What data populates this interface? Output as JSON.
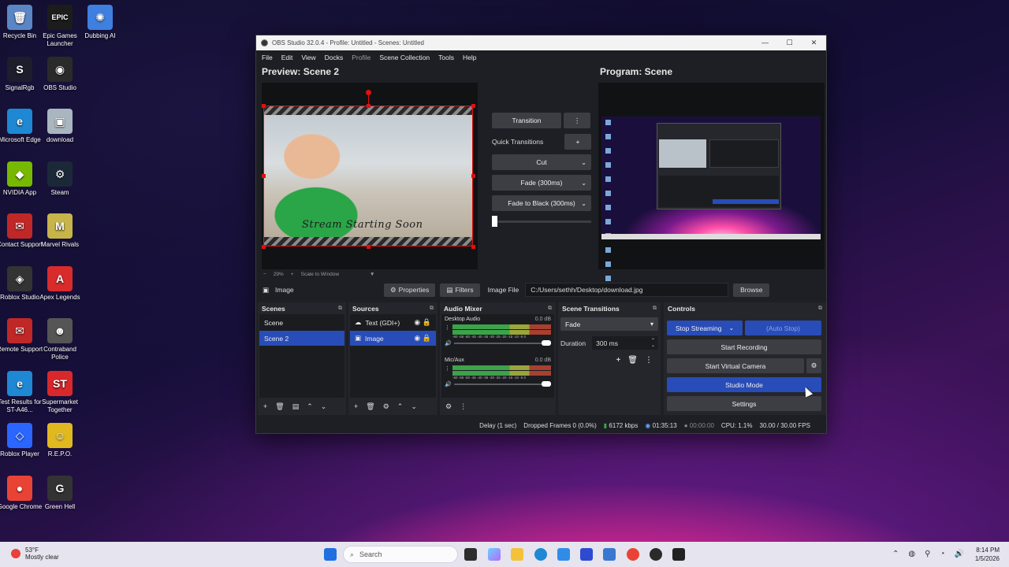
{
  "desktop": {
    "icons": [
      {
        "label": "Recycle Bin",
        "glyph": "🗑",
        "color": "#5b86c6"
      },
      {
        "label": "Epic Games Launcher",
        "glyph": "EPIC",
        "color": "#1c1c1c"
      },
      {
        "label": "Dubbing AI",
        "glyph": "✺",
        "color": "#3f7fe0"
      },
      {
        "label": "SignalRgb",
        "glyph": "S",
        "color": "#1d1d2c"
      },
      {
        "label": "OBS Studio",
        "glyph": "◉",
        "color": "#2a2a2a"
      },
      {
        "label": "Microsoft Edge",
        "glyph": "e",
        "color": "#1e88d4"
      },
      {
        "label": "download",
        "glyph": "▣",
        "color": "#a9b6c0"
      },
      {
        "label": "NVIDIA App",
        "glyph": "◆",
        "color": "#76b900"
      },
      {
        "label": "Steam",
        "glyph": "⚙",
        "color": "#1b2838"
      },
      {
        "label": "Contact Support",
        "glyph": "✉",
        "color": "#c02828"
      },
      {
        "label": "Marvel Rivals",
        "glyph": "M",
        "color": "#c7b44a"
      },
      {
        "label": "Roblox Studio",
        "glyph": "◈",
        "color": "#333"
      },
      {
        "label": "Apex Legends",
        "glyph": "A",
        "color": "#d82b2b"
      },
      {
        "label": "Remote Support",
        "glyph": "✉",
        "color": "#c02828"
      },
      {
        "label": "Contraband Police",
        "glyph": "☻",
        "color": "#555"
      },
      {
        "label": "Test Results for ST-A46...",
        "glyph": "e",
        "color": "#1e88d4"
      },
      {
        "label": "Supermarket Together",
        "glyph": "ST",
        "color": "#d8282b"
      },
      {
        "label": "Roblox Player",
        "glyph": "◇",
        "color": "#2a66ff"
      },
      {
        "label": "R.E.P.O.",
        "glyph": "☺",
        "color": "#e0b820"
      },
      {
        "label": "Google Chrome",
        "glyph": "●",
        "color": "#e94335"
      },
      {
        "label": "Green Hell",
        "glyph": "G",
        "color": "#333"
      }
    ]
  },
  "window": {
    "title": "OBS Studio 32.0.4 - Profile: Untitled - Scenes: Untitled",
    "controls": {
      "minimize": "—",
      "maximize": "☐",
      "close": "✕"
    }
  },
  "menu": [
    "File",
    "Edit",
    "View",
    "Docks",
    "Profile",
    "Scene Collection",
    "Tools",
    "Help"
  ],
  "preview": {
    "title": "Preview: Scene 2",
    "overlay_text": "Stream Starting Soon",
    "zoom": "29%",
    "zoom_minus": "−",
    "zoom_plus": "+",
    "zoom_mode": "Scale to Window"
  },
  "program": {
    "title": "Program: Scene"
  },
  "transitions_panel": {
    "transition_label": "Transition",
    "quick_transitions_label": "Quick Transitions",
    "quick_list": [
      "Cut",
      "Fade (300ms)",
      "Fade to Black (300ms)"
    ]
  },
  "properties_bar": {
    "source_name": "Image",
    "properties_label": "Properties",
    "filters_label": "Filters",
    "image_file_label": "Image File",
    "path": "C:/Users/sethh/Desktop/download.jpg",
    "browse_label": "Browse"
  },
  "scenes": {
    "title": "Scenes",
    "items": [
      "Scene",
      "Scene 2"
    ],
    "selected": 1
  },
  "sources": {
    "title": "Sources",
    "items": [
      "Text (GDI+)",
      "Image"
    ],
    "selected": 1
  },
  "audio_mixer": {
    "title": "Audio Mixer",
    "scale": "-60 -55 -50 -45 -40 -35 -30 -25 -20 -15 -10 -5 0",
    "channels": [
      {
        "name": "Desktop Audio",
        "level": "0.0 dB"
      },
      {
        "name": "Mic/Aux",
        "level": "0.0 dB"
      }
    ]
  },
  "scene_transitions": {
    "title": "Scene Transitions",
    "selected": "Fade",
    "duration_label": "Duration",
    "duration_value": "300 ms"
  },
  "controls": {
    "title": "Controls",
    "stop_streaming": "Stop Streaming",
    "auto_stop": "(Auto Stop)",
    "start_recording": "Start Recording",
    "start_virtual_camera": "Start Virtual Camera",
    "studio_mode": "Studio Mode",
    "settings": "Settings"
  },
  "status": {
    "delay": "Delay (1 sec)",
    "dropped": "Dropped Frames 0 (0.0%)",
    "bitrate": "6172 kbps",
    "stream_time": "01:35:13",
    "record_time": "00:00:00",
    "cpu": "CPU: 1.1%",
    "fps": "30.00 / 30.00 FPS"
  },
  "taskbar": {
    "weather_temp": "53°F",
    "weather_desc": "Mostly clear",
    "search_placeholder": "Search",
    "time": "8:14 PM",
    "date": "1/5/2026"
  },
  "colors": {
    "accent": "#284cb8",
    "selection_border": "#e01010"
  }
}
